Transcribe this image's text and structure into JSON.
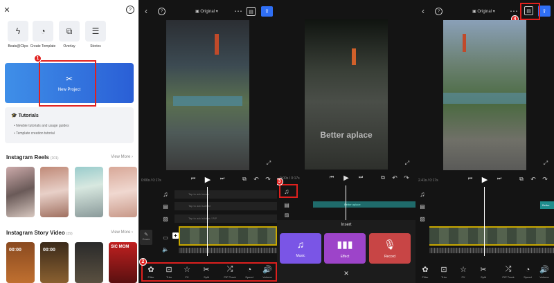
{
  "panel1": {
    "tools": [
      {
        "label": "Beats@Clips",
        "icon": "lightning-icon"
      },
      {
        "label": "Create Template",
        "icon": "template-icon"
      },
      {
        "label": "Overlay",
        "icon": "overlay-icon"
      },
      {
        "label": "Stories",
        "icon": "stories-icon"
      }
    ],
    "new_project": "New Project",
    "step1": "1",
    "tutorials": {
      "title": "Tutorials",
      "items": [
        "Newbie tutorials and usage guides",
        "Template creation tutorial"
      ]
    },
    "reels": {
      "title": "Instagram Reels",
      "count": "(101)",
      "view_more": "View More"
    },
    "stories": {
      "title": "Instagram Story Video",
      "count": "(39)",
      "view_more": "View More"
    },
    "story_thumbs": {
      "t1": "00:00",
      "t2": "00:00",
      "t4": "SIC MOM"
    }
  },
  "panel2": {
    "ratio": "Original",
    "time": "0:00s / 0:17s",
    "tracks": [
      "Tap to add music",
      "Tap to add subtitle",
      "Tap to add sticker / PIP"
    ],
    "cover": "Cover",
    "step2": "2",
    "tools": [
      {
        "label": "Filter",
        "icon": "filter-icon"
      },
      {
        "label": "Trim",
        "icon": "trim-icon"
      },
      {
        "label": "FX",
        "icon": "fx-icon"
      },
      {
        "label": "Split",
        "icon": "split-icon"
      },
      {
        "label": "PIP Track",
        "icon": "pip-icon"
      },
      {
        "label": "Speed",
        "icon": "speed-icon"
      },
      {
        "label": "Volume",
        "icon": "volume-icon"
      }
    ]
  },
  "panel3": {
    "overlay_text": "Better aplace",
    "time": "0:00s / 0:17s",
    "subtitle_clip": "Better aplace",
    "step3": "3",
    "insert_title": "Insert",
    "options": [
      {
        "label": "Music",
        "icon": "music-icon",
        "color": "#7a55e6"
      },
      {
        "label": "Effect",
        "icon": "waveform-icon",
        "color": "#9d44c9"
      },
      {
        "label": "Record",
        "icon": "microphone-icon",
        "color": "#c84545"
      }
    ],
    "close": "✕"
  },
  "panel4": {
    "ratio": "Original",
    "time": "2.41s / 0:17s",
    "subtitle_clip": "Better",
    "step4": "4",
    "tools": [
      {
        "label": "Filter",
        "icon": "filter-icon"
      },
      {
        "label": "Trim",
        "icon": "trim-icon"
      },
      {
        "label": "FX",
        "icon": "fx-icon"
      },
      {
        "label": "Split",
        "icon": "split-icon"
      },
      {
        "label": "PIP Track",
        "icon": "pip-icon"
      },
      {
        "label": "Speed",
        "icon": "speed-icon"
      },
      {
        "label": "Volume",
        "icon": "volume-icon"
      }
    ]
  },
  "colors": {
    "accent_blue": "#2f6ff5",
    "annotation_red": "#e0201e",
    "timeline_yellow": "#c9a800",
    "subtitle_teal": "#1f8d8d"
  }
}
